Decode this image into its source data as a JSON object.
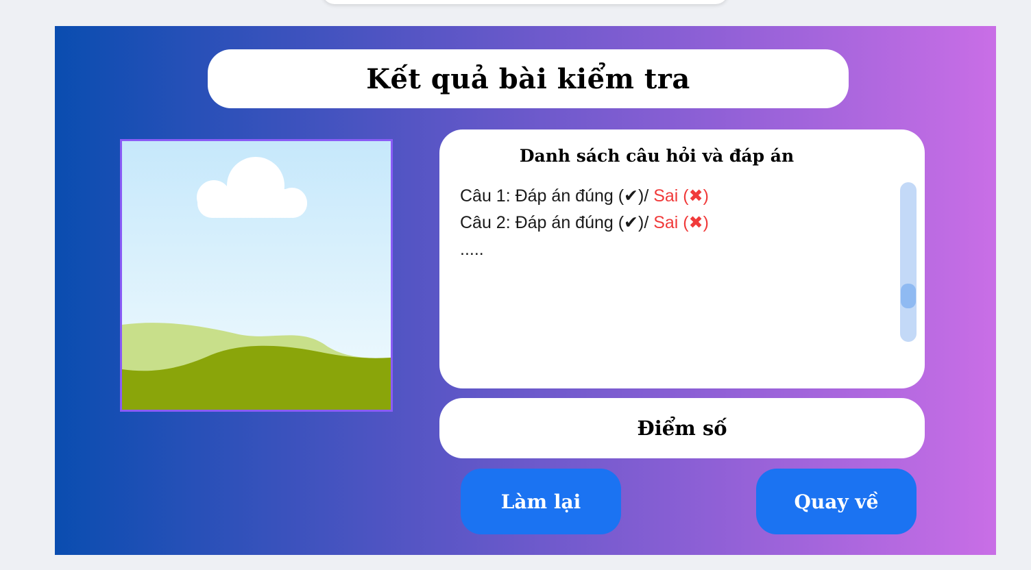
{
  "colors": {
    "accent": "#1b73f2",
    "wrong": "#f03a3a",
    "gradient_start": "#0a4db0",
    "gradient_end": "#c96ee6",
    "image_border": "#8a5cf6"
  },
  "header": {
    "title": "Kết quả bài kiểm tra"
  },
  "image": {
    "icon": "landscape-placeholder-icon"
  },
  "qa": {
    "heading": "Danh sách câu hỏi và đáp án",
    "items": [
      {
        "prefix": "Câu 1: Đáp án đúng (✔)/ ",
        "wrong": "Sai (✖)"
      },
      {
        "prefix": "Câu 2: Đáp án đúng (✔)/ ",
        "wrong": "Sai (✖)"
      }
    ],
    "ellipsis": "....."
  },
  "score": {
    "label": "Điểm số"
  },
  "buttons": {
    "retry": "Làm lại",
    "back": "Quay về"
  }
}
